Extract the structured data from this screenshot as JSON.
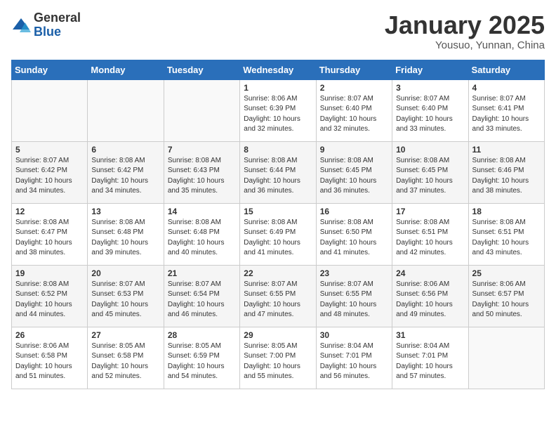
{
  "header": {
    "logo_general": "General",
    "logo_blue": "Blue",
    "title": "January 2025",
    "subtitle": "Yousuo, Yunnan, China"
  },
  "weekdays": [
    "Sunday",
    "Monday",
    "Tuesday",
    "Wednesday",
    "Thursday",
    "Friday",
    "Saturday"
  ],
  "weeks": [
    [
      {
        "day": "",
        "info": ""
      },
      {
        "day": "",
        "info": ""
      },
      {
        "day": "",
        "info": ""
      },
      {
        "day": "1",
        "info": "Sunrise: 8:06 AM\nSunset: 6:39 PM\nDaylight: 10 hours\nand 32 minutes."
      },
      {
        "day": "2",
        "info": "Sunrise: 8:07 AM\nSunset: 6:40 PM\nDaylight: 10 hours\nand 32 minutes."
      },
      {
        "day": "3",
        "info": "Sunrise: 8:07 AM\nSunset: 6:40 PM\nDaylight: 10 hours\nand 33 minutes."
      },
      {
        "day": "4",
        "info": "Sunrise: 8:07 AM\nSunset: 6:41 PM\nDaylight: 10 hours\nand 33 minutes."
      }
    ],
    [
      {
        "day": "5",
        "info": "Sunrise: 8:07 AM\nSunset: 6:42 PM\nDaylight: 10 hours\nand 34 minutes."
      },
      {
        "day": "6",
        "info": "Sunrise: 8:08 AM\nSunset: 6:42 PM\nDaylight: 10 hours\nand 34 minutes."
      },
      {
        "day": "7",
        "info": "Sunrise: 8:08 AM\nSunset: 6:43 PM\nDaylight: 10 hours\nand 35 minutes."
      },
      {
        "day": "8",
        "info": "Sunrise: 8:08 AM\nSunset: 6:44 PM\nDaylight: 10 hours\nand 36 minutes."
      },
      {
        "day": "9",
        "info": "Sunrise: 8:08 AM\nSunset: 6:45 PM\nDaylight: 10 hours\nand 36 minutes."
      },
      {
        "day": "10",
        "info": "Sunrise: 8:08 AM\nSunset: 6:45 PM\nDaylight: 10 hours\nand 37 minutes."
      },
      {
        "day": "11",
        "info": "Sunrise: 8:08 AM\nSunset: 6:46 PM\nDaylight: 10 hours\nand 38 minutes."
      }
    ],
    [
      {
        "day": "12",
        "info": "Sunrise: 8:08 AM\nSunset: 6:47 PM\nDaylight: 10 hours\nand 38 minutes."
      },
      {
        "day": "13",
        "info": "Sunrise: 8:08 AM\nSunset: 6:48 PM\nDaylight: 10 hours\nand 39 minutes."
      },
      {
        "day": "14",
        "info": "Sunrise: 8:08 AM\nSunset: 6:48 PM\nDaylight: 10 hours\nand 40 minutes."
      },
      {
        "day": "15",
        "info": "Sunrise: 8:08 AM\nSunset: 6:49 PM\nDaylight: 10 hours\nand 41 minutes."
      },
      {
        "day": "16",
        "info": "Sunrise: 8:08 AM\nSunset: 6:50 PM\nDaylight: 10 hours\nand 41 minutes."
      },
      {
        "day": "17",
        "info": "Sunrise: 8:08 AM\nSunset: 6:51 PM\nDaylight: 10 hours\nand 42 minutes."
      },
      {
        "day": "18",
        "info": "Sunrise: 8:08 AM\nSunset: 6:51 PM\nDaylight: 10 hours\nand 43 minutes."
      }
    ],
    [
      {
        "day": "19",
        "info": "Sunrise: 8:08 AM\nSunset: 6:52 PM\nDaylight: 10 hours\nand 44 minutes."
      },
      {
        "day": "20",
        "info": "Sunrise: 8:07 AM\nSunset: 6:53 PM\nDaylight: 10 hours\nand 45 minutes."
      },
      {
        "day": "21",
        "info": "Sunrise: 8:07 AM\nSunset: 6:54 PM\nDaylight: 10 hours\nand 46 minutes."
      },
      {
        "day": "22",
        "info": "Sunrise: 8:07 AM\nSunset: 6:55 PM\nDaylight: 10 hours\nand 47 minutes."
      },
      {
        "day": "23",
        "info": "Sunrise: 8:07 AM\nSunset: 6:55 PM\nDaylight: 10 hours\nand 48 minutes."
      },
      {
        "day": "24",
        "info": "Sunrise: 8:06 AM\nSunset: 6:56 PM\nDaylight: 10 hours\nand 49 minutes."
      },
      {
        "day": "25",
        "info": "Sunrise: 8:06 AM\nSunset: 6:57 PM\nDaylight: 10 hours\nand 50 minutes."
      }
    ],
    [
      {
        "day": "26",
        "info": "Sunrise: 8:06 AM\nSunset: 6:58 PM\nDaylight: 10 hours\nand 51 minutes."
      },
      {
        "day": "27",
        "info": "Sunrise: 8:05 AM\nSunset: 6:58 PM\nDaylight: 10 hours\nand 52 minutes."
      },
      {
        "day": "28",
        "info": "Sunrise: 8:05 AM\nSunset: 6:59 PM\nDaylight: 10 hours\nand 54 minutes."
      },
      {
        "day": "29",
        "info": "Sunrise: 8:05 AM\nSunset: 7:00 PM\nDaylight: 10 hours\nand 55 minutes."
      },
      {
        "day": "30",
        "info": "Sunrise: 8:04 AM\nSunset: 7:01 PM\nDaylight: 10 hours\nand 56 minutes."
      },
      {
        "day": "31",
        "info": "Sunrise: 8:04 AM\nSunset: 7:01 PM\nDaylight: 10 hours\nand 57 minutes."
      },
      {
        "day": "",
        "info": ""
      }
    ]
  ]
}
